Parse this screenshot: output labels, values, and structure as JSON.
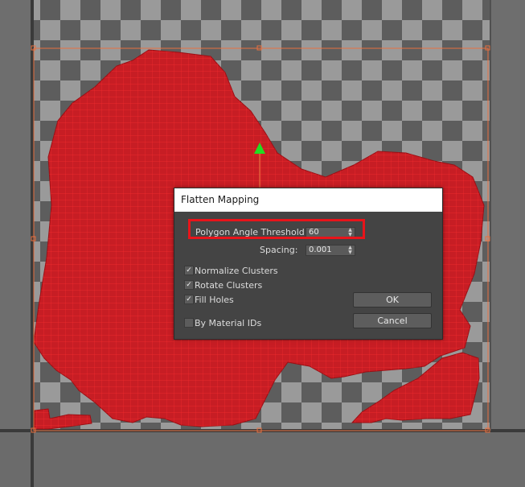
{
  "dialog": {
    "title": "Flatten Mapping",
    "polygon_angle_threshold": {
      "label": "Polygon Angle Threshold:",
      "value": "60"
    },
    "spacing": {
      "label": "Spacing:",
      "value": "0.001"
    },
    "options": [
      {
        "label": "Normalize Clusters",
        "checked": true
      },
      {
        "label": "Rotate Clusters",
        "checked": true
      },
      {
        "label": "Fill Holes",
        "checked": true
      },
      {
        "label": "By Material IDs",
        "checked": false
      }
    ],
    "ok_label": "OK",
    "cancel_label": "Cancel",
    "spinner_icon": "spinner-arrows",
    "check_glyph": "✓"
  },
  "colors": {
    "uv_mesh": "#d21c22",
    "annotation": "#e8141a",
    "gizmo": "#22dd22",
    "bounds": "#e87040"
  }
}
